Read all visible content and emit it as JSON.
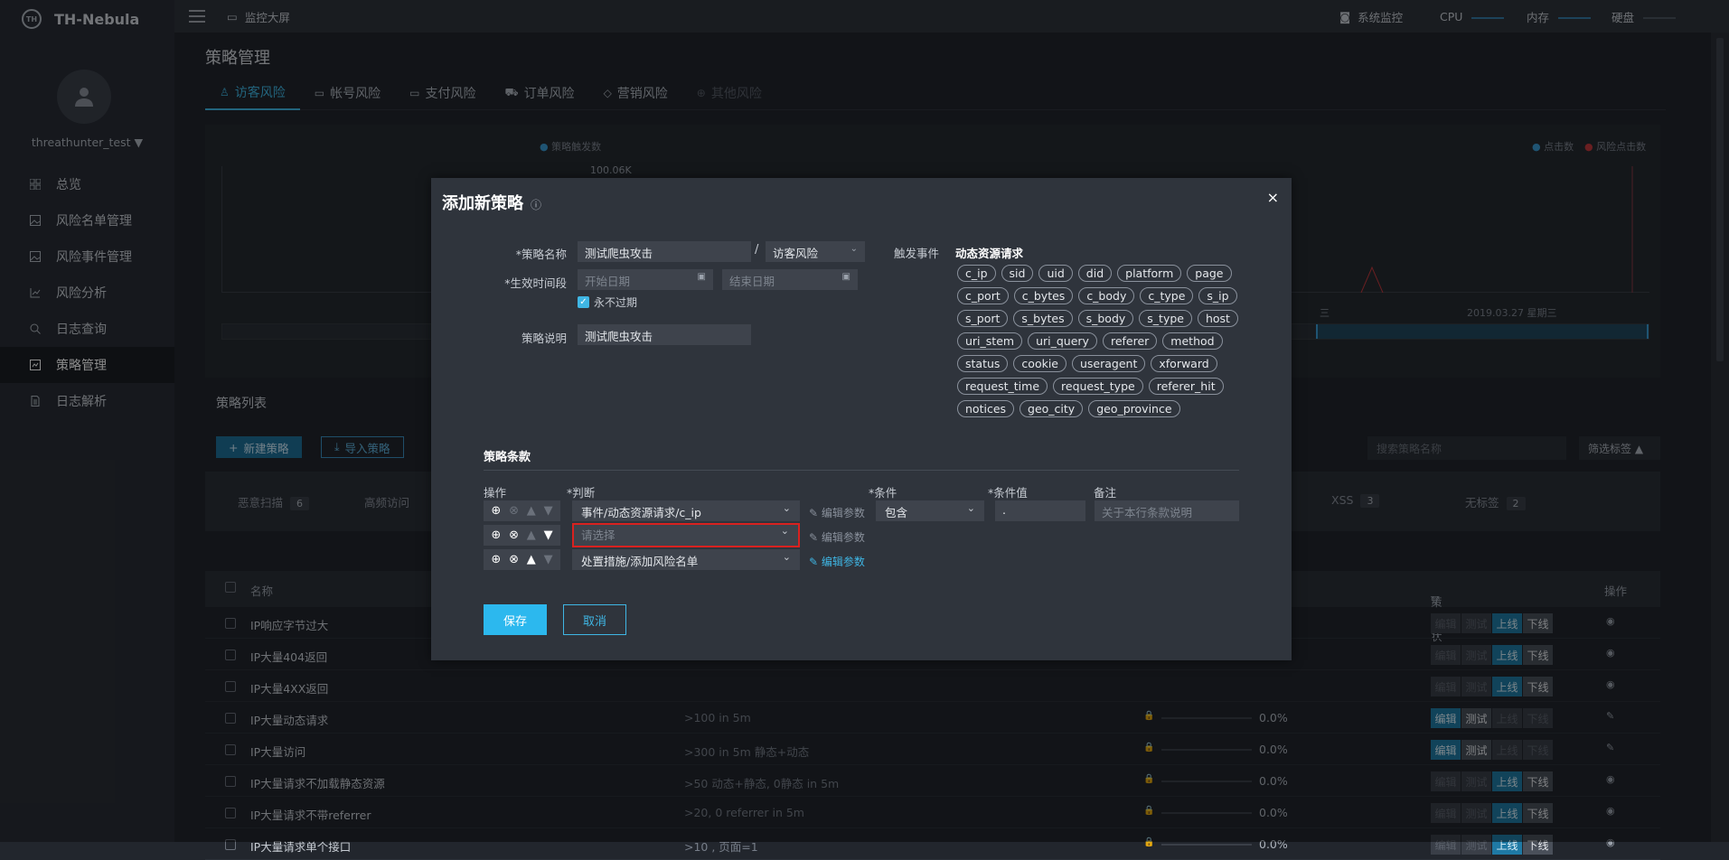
{
  "app": {
    "logo": "TH-Nebula",
    "logo_mark": "TH"
  },
  "sidebar": {
    "username": "threathunter_test",
    "items": [
      {
        "label": "总览",
        "icon": "grid-icon"
      },
      {
        "label": "风险名单管理",
        "icon": "image-icon"
      },
      {
        "label": "风险事件管理",
        "icon": "image-icon"
      },
      {
        "label": "风险分析",
        "icon": "line-chart-icon"
      },
      {
        "label": "日志查询",
        "icon": "search-icon"
      },
      {
        "label": "策略管理",
        "icon": "strategy-icon",
        "active": true
      },
      {
        "label": "日志解析",
        "icon": "document-icon"
      }
    ]
  },
  "topbar": {
    "monitor_screen": "监控大屏",
    "sys_monitor": "系统监控",
    "cpu": "CPU",
    "mem": "内存",
    "disk": "硬盘"
  },
  "page": {
    "title": "策略管理",
    "tabs": [
      {
        "label": "访客风险",
        "icon": "user-icon",
        "active": true
      },
      {
        "label": "帐号风险",
        "icon": "card-icon"
      },
      {
        "label": "支付风险",
        "icon": "card-icon"
      },
      {
        "label": "订单风险",
        "icon": "cart-icon"
      },
      {
        "label": "营销风险",
        "icon": "tag-icon"
      },
      {
        "label": "其他风险",
        "icon": "plus-circle-icon",
        "disabled": true
      }
    ]
  },
  "chart": {
    "legend_left": "策略触发数",
    "legend_right1": "点击数",
    "legend_right2": "风险点击数",
    "ymax": "100.06K",
    "xdate_left": "三",
    "xdate": "2019.03.27 星期三"
  },
  "list": {
    "title": "策略列表",
    "new_btn": "新建策略",
    "import_btn": "导入策略",
    "search_placeholder": "搜索策略名称",
    "filter": "筛选标签",
    "tags": [
      {
        "label": "恶意扫描",
        "count": "6"
      },
      {
        "label": "高频访问",
        "count": ""
      },
      {
        "label": "XSS",
        "count": "3"
      },
      {
        "label": "无标签",
        "count": "2"
      }
    ],
    "headers": {
      "name": "名称",
      "status": "策略状态",
      "op": "操作"
    },
    "status_labels": {
      "edit": "编辑",
      "test": "测试",
      "online": "上线",
      "offline": "下线"
    },
    "rows": [
      {
        "name": "IP响应字节过大",
        "desc": "",
        "pct": ""
      },
      {
        "name": "IP大量404返回",
        "desc": "",
        "pct": ""
      },
      {
        "name": "IP大量4XX返回",
        "desc": "",
        "pct": ""
      },
      {
        "name": "IP大量动态请求",
        "desc": ">100 in 5m",
        "pct": "0.0%"
      },
      {
        "name": "IP大量访问",
        "desc": ">300 in 5m 静态+动态",
        "pct": "0.0%"
      },
      {
        "name": "IP大量请求不加载静态资源",
        "desc": ">50 动态+静态, 0静态 in 5m",
        "pct": "0.0%"
      },
      {
        "name": "IP大量请求不带referrer",
        "desc": ">20, 0 referrer in 5m",
        "pct": "0.0%"
      },
      {
        "name": "IP大量请求单个接口",
        "desc": ">10 , 页面=1",
        "pct": "0.0%"
      }
    ]
  },
  "modal": {
    "title": "添加新策略",
    "close": "×",
    "name_label": "*策略名称",
    "name_value": "测试爬虫攻击",
    "risk_type": "访客风险",
    "period_label": "*生效时间段",
    "start_placeholder": "开始日期",
    "end_placeholder": "结束日期",
    "never_expire": "永不过期",
    "desc_label": "策略说明",
    "desc_value": "测试爬虫攻击",
    "trigger_label": "触发事件",
    "trigger_value": "动态资源请求",
    "fields": [
      "c_ip",
      "sid",
      "uid",
      "did",
      "platform",
      "page",
      "c_port",
      "c_bytes",
      "c_body",
      "c_type",
      "s_ip",
      "s_port",
      "s_bytes",
      "s_body",
      "s_type",
      "host",
      "uri_stem",
      "uri_query",
      "referer",
      "method",
      "status",
      "cookie",
      "useragent",
      "xforward",
      "request_time",
      "request_type",
      "referer_hit",
      "notices",
      "geo_city",
      "geo_province"
    ],
    "clause_title": "策略条款",
    "col_op": "操作",
    "col_judge": "*判断",
    "col_cond": "*条件",
    "col_val": "*条件值",
    "col_note": "备注",
    "rows": [
      {
        "judge": "事件/动态资源请求/c_ip",
        "edit": "编辑参数",
        "cond": "包含",
        "val": ".",
        "note_placeholder": "关于本行条款说明"
      },
      {
        "judge": "请选择",
        "edit": "编辑参数"
      },
      {
        "judge": "处置措施/添加风险名单",
        "edit": "编辑参数"
      }
    ],
    "save": "保存",
    "cancel": "取消"
  }
}
